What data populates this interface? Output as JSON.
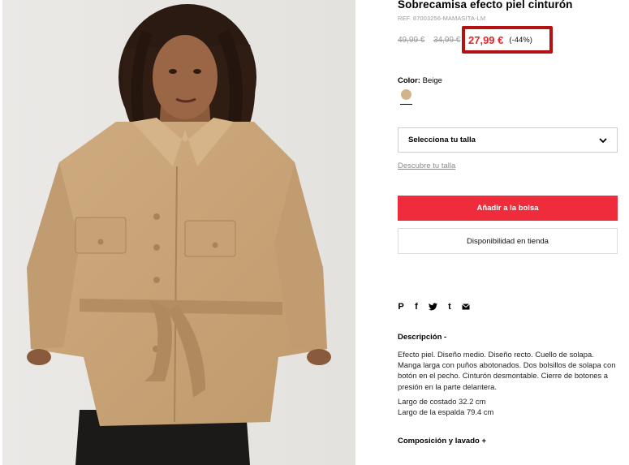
{
  "product": {
    "title": "Sobrecamisa efecto piel cinturón",
    "ref": "REF. 87003256-MAMASITA-LM",
    "prices": {
      "original": "49,99 €",
      "previous": "34,99 €",
      "current": "27,99 €",
      "discount": "(-44%)"
    },
    "color": {
      "label": "Color:",
      "value": "Beige",
      "swatch": "#d2b48c"
    }
  },
  "size": {
    "select_label": "Selecciona tu talla",
    "guide_link": "Descubre tu talla"
  },
  "actions": {
    "add_to_bag": "Añadir a la bolsa",
    "store_availability": "Disponibilidad en tienda"
  },
  "share": {
    "icons": [
      "pinterest-icon",
      "facebook-icon",
      "twitter-icon",
      "tumblr-icon",
      "email-icon"
    ],
    "pinterest_glyph": "P",
    "facebook_glyph": "f",
    "twitter_glyph": "♥",
    "tumblr_glyph": "t",
    "email_glyph": "✉"
  },
  "description": {
    "heading": "Descripción -",
    "body": "Efecto piel. Diseño medio. Diseño recto. Cuello de solapa. Manga larga con puños abotonados. Dos bolsillos de solapa con botón en el pecho. Cinturón desmontable. Cierre de botones a presión en la parte delantera.",
    "side_length": "Largo de costado 32.2 cm",
    "back_length": "Largo de la espalda 79.4 cm"
  },
  "composition": {
    "heading": "Composición y lavado +"
  },
  "colors": {
    "accent_red": "#ef2c3c",
    "price_red": "#e3262e",
    "highlight_border": "#b41212",
    "jacket": "#c9a57b"
  }
}
